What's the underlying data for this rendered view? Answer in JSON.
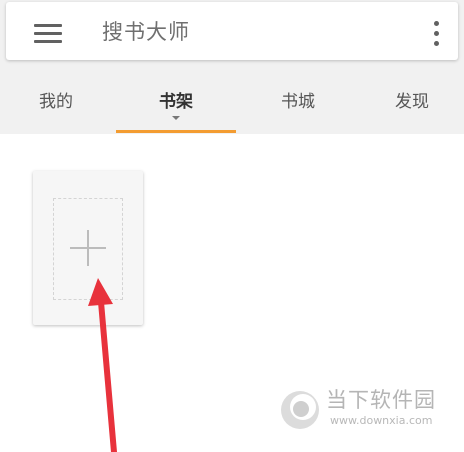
{
  "header": {
    "title": "搜书大师",
    "menu_icon": "hamburger-menu-icon",
    "more_icon": "more-vertical-icon"
  },
  "tabs": [
    {
      "label": "我的"
    },
    {
      "label": "书架",
      "active": true
    },
    {
      "label": "书城"
    },
    {
      "label": "发现"
    }
  ],
  "bookshelf": {
    "add_icon": "plus-icon"
  },
  "watermark": {
    "name": "当下软件园",
    "url": "www.downxia.com"
  },
  "colors": {
    "accent": "#f39c31",
    "arrow": "#e8323c",
    "background": "#f1f1f1"
  }
}
